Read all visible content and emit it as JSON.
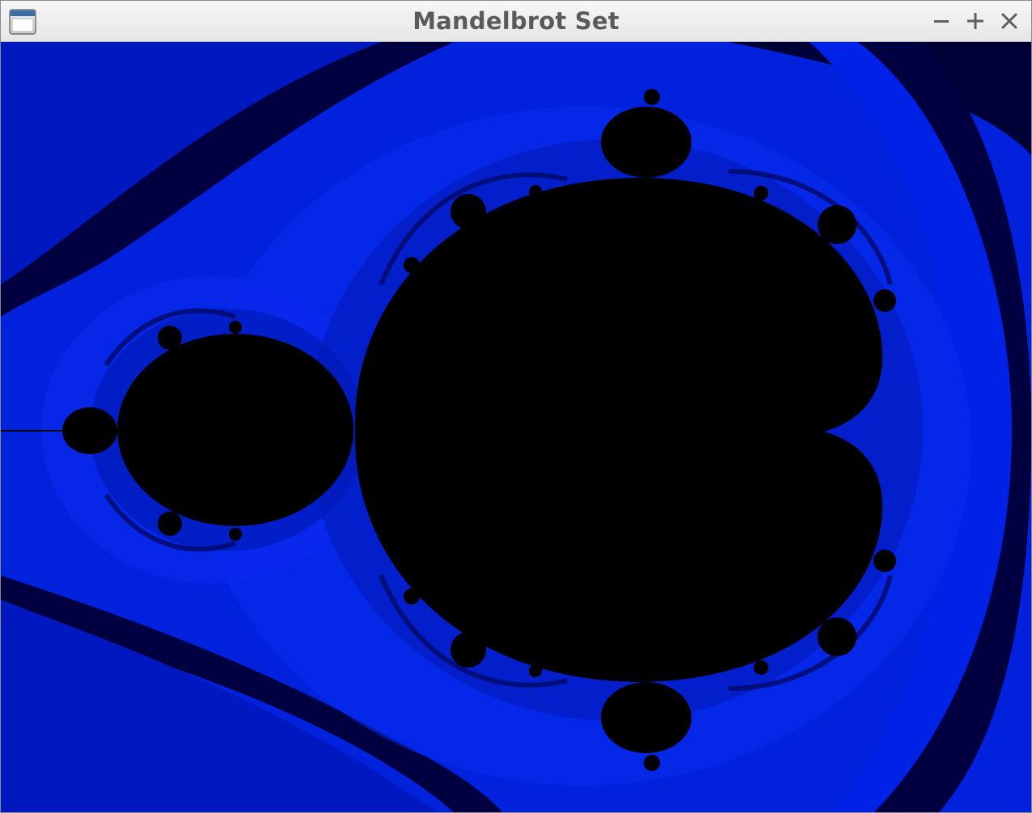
{
  "window": {
    "title": "Mandelbrot Set",
    "icon": "app-window-icon",
    "controls": {
      "minimize_icon": "minimize-icon",
      "maximize_icon": "maximize-icon",
      "close_icon": "close-icon"
    }
  },
  "fractal": {
    "colors": {
      "set": "#000000",
      "band_darkest": "#000038",
      "band_dark": "#00088c",
      "band_mid": "#0018c8",
      "band_bright": "#0026ee",
      "band_brightest": "#0a30ff"
    }
  }
}
